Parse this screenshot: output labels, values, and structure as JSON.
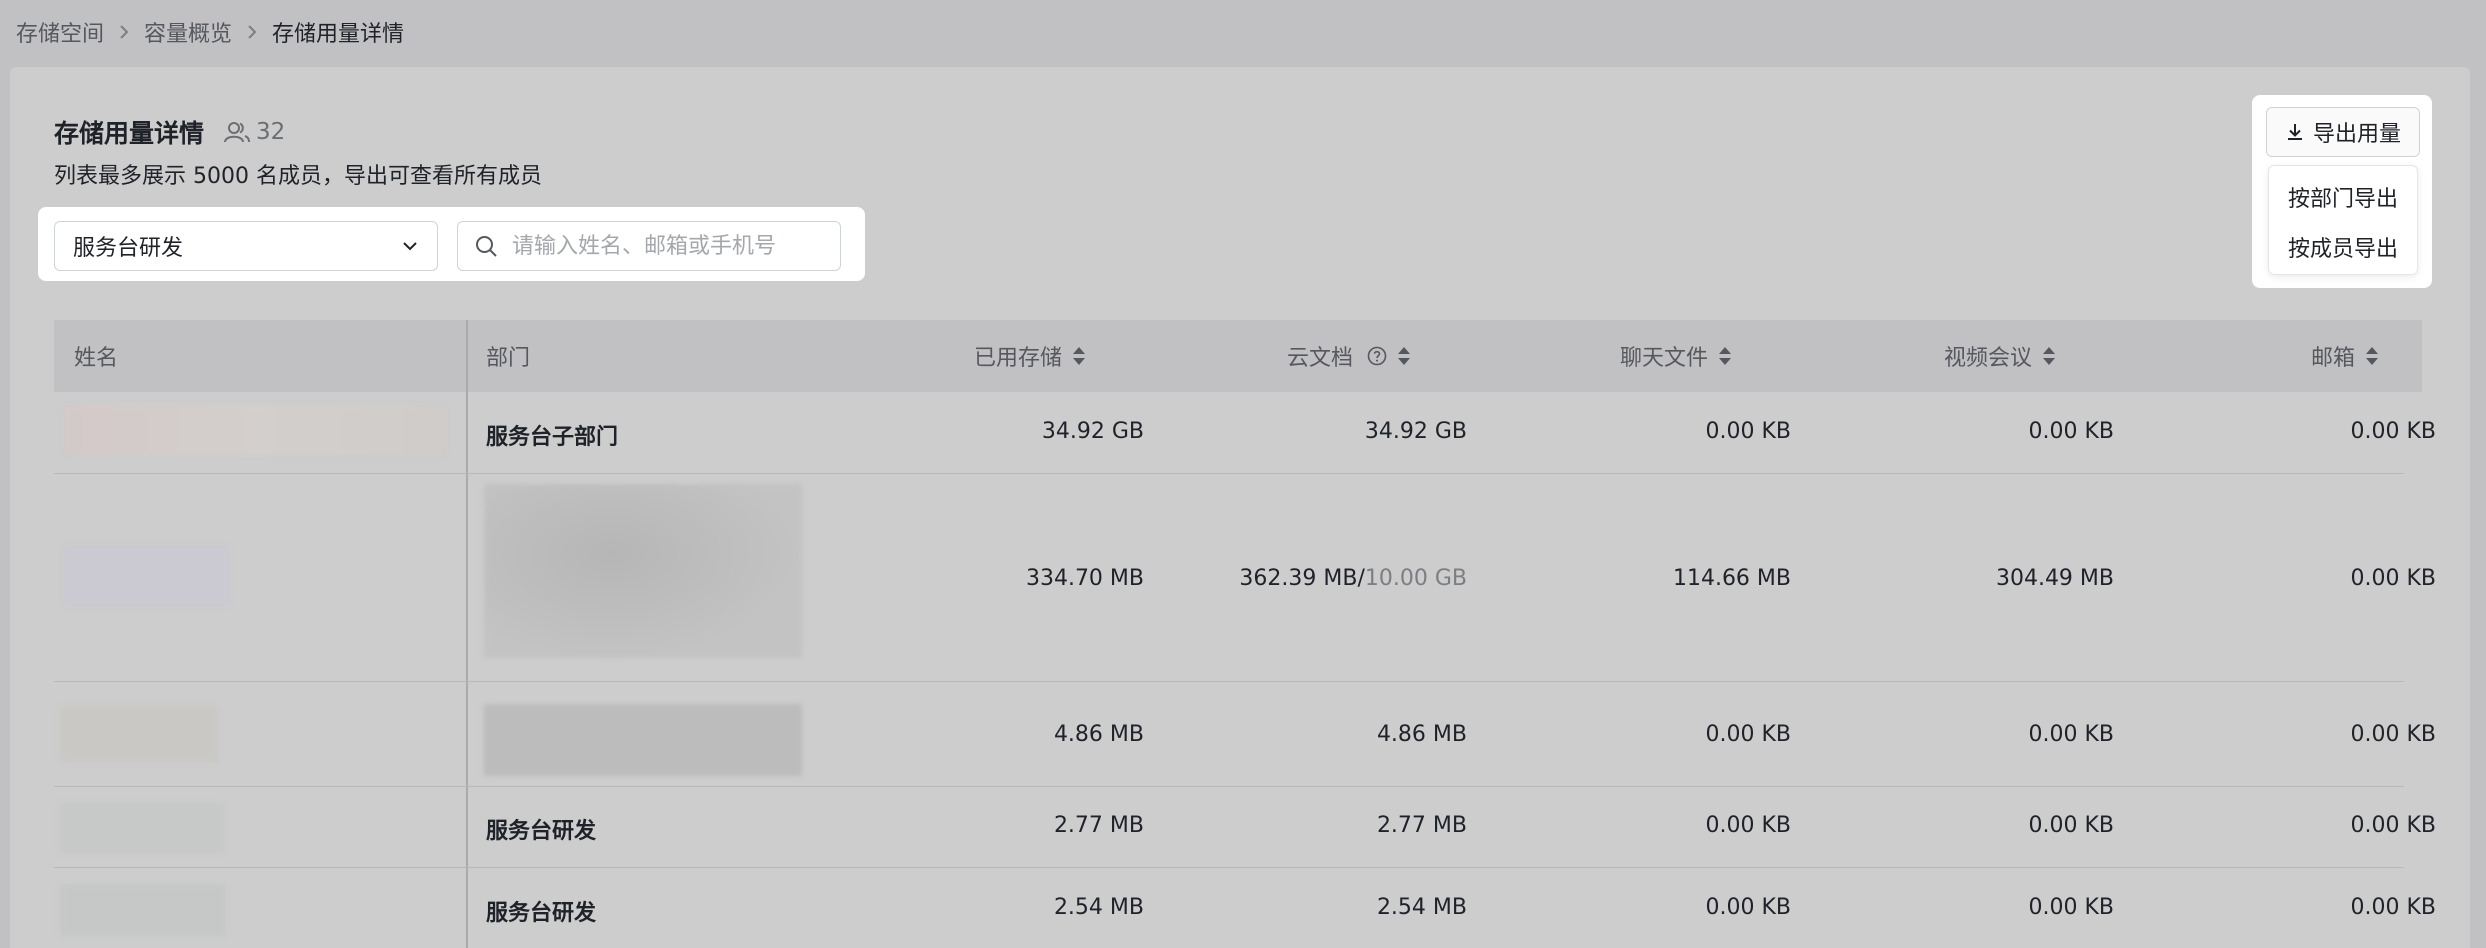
{
  "breadcrumb": {
    "items": [
      "存储空间",
      "容量概览",
      "存储用量详情"
    ]
  },
  "header": {
    "title": "存储用量详情",
    "member_count": "32",
    "subtitle": "列表最多展示 5000 名成员，导出可查看所有成员"
  },
  "filters": {
    "department_value": "服务台研发",
    "search_placeholder": "请输入姓名、邮箱或手机号"
  },
  "export": {
    "button_label": "导出用量",
    "menu": [
      "按部门导出",
      "按成员导出"
    ]
  },
  "table": {
    "columns": [
      "姓名",
      "部门",
      "已用存储",
      "云文档",
      "聊天文件",
      "视频会议",
      "邮箱"
    ],
    "rows": [
      {
        "dept": "服务台子部门",
        "used": "34.92 GB",
        "doc": "34.92 GB",
        "doc_quota": "",
        "chat": "0.00 KB",
        "video": "0.00 KB",
        "mail": "0.00 KB"
      },
      {
        "dept": "",
        "used": "334.70 MB",
        "doc": "362.39 MB/",
        "doc_quota": "10.00 GB",
        "chat": "114.66 MB",
        "video": "304.49 MB",
        "mail": "0.00 KB"
      },
      {
        "dept": "",
        "used": "4.86 MB",
        "doc": "4.86 MB",
        "doc_quota": "",
        "chat": "0.00 KB",
        "video": "0.00 KB",
        "mail": "0.00 KB"
      },
      {
        "dept": "服务台研发",
        "used": "2.77 MB",
        "doc": "2.77 MB",
        "doc_quota": "",
        "chat": "0.00 KB",
        "video": "0.00 KB",
        "mail": "0.00 KB"
      },
      {
        "dept": "服务台研发",
        "used": "2.54 MB",
        "doc": "2.54 MB",
        "doc_quota": "",
        "chat": "0.00 KB",
        "video": "0.00 KB",
        "mail": "0.00 KB"
      }
    ]
  }
}
